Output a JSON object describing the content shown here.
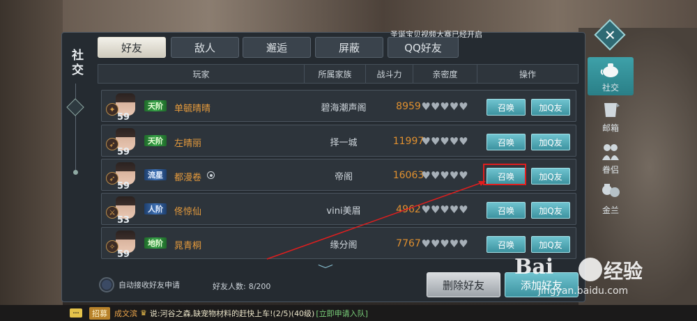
{
  "panel": {
    "side_title": "社交",
    "notice": "圣诞宝贝视频大赛已经开启"
  },
  "tabs": [
    {
      "label": "好友",
      "active": true
    },
    {
      "label": "敌人",
      "active": false
    },
    {
      "label": "邂逅",
      "active": false
    },
    {
      "label": "屏蔽",
      "active": false
    },
    {
      "label": "QQ好友",
      "active": false
    }
  ],
  "side_nav": [
    {
      "label": "社交",
      "icon": "teapot-icon",
      "active": true
    },
    {
      "label": "邮箱",
      "icon": "scroll-icon",
      "active": false
    },
    {
      "label": "眷侣",
      "icon": "couple-icon",
      "active": false
    },
    {
      "label": "金兰",
      "icon": "brothers-icon",
      "active": false
    }
  ],
  "table": {
    "headers": [
      "玩家",
      "所属家族",
      "战斗力",
      "亲密度",
      "操作"
    ],
    "rows": [
      {
        "rank": "天阶",
        "rank_color": "green",
        "name": "单毓晴晴",
        "level": "59",
        "family": "碧海潮声阁",
        "power": "8959",
        "online": false
      },
      {
        "rank": "天阶",
        "rank_color": "green",
        "name": "左晴丽",
        "level": "59",
        "family": "择一城",
        "power": "11997",
        "online": false
      },
      {
        "rank": "流星",
        "rank_color": "blue",
        "name": "都漫卷",
        "level": "59",
        "family": "帝阁",
        "power": "16063",
        "online": true
      },
      {
        "rank": "人阶",
        "rank_color": "blue",
        "name": "佟惊仙",
        "level": "53",
        "family": "vini美眉",
        "power": "4962",
        "online": false
      },
      {
        "rank": "地阶",
        "rank_color": "green",
        "name": "晁青桐",
        "level": "59",
        "family": "缘分阁",
        "power": "7767",
        "online": false
      }
    ],
    "intimacy_hearts": "♥♥♥♥♥",
    "summon_label": "召唤",
    "add_qq_label": "加Q友"
  },
  "footer": {
    "auto_accept_label": "自动接收好友申请",
    "friend_count_label": "好友人数:",
    "friend_count_value": "8/200",
    "delete_label": "删除好友",
    "add_label": "添加好友"
  },
  "chat": {
    "tag": "招募",
    "user": "成文滨",
    "message": "说:河谷之森,缺宠物材料的赶快上车!(2/5)(40级)",
    "link": "[立即申请入队]"
  },
  "watermark": {
    "text": "Bai",
    "text2": "经验",
    "url": "jingyan.baidu.com"
  },
  "colors": {
    "accent": "#3d93a0",
    "power": "#e0902f",
    "player_name": "#e49a3c",
    "highlight": "#e01e1e"
  }
}
